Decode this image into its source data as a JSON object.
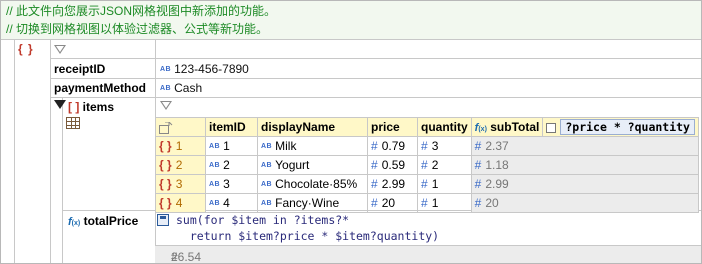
{
  "comments": [
    "// 此文件向您展示JSON网格视图中新添加的功能。",
    "// 切换到网格视图以体验过滤器、公式等新功能。"
  ],
  "root": {
    "brace": "{ }"
  },
  "fields": [
    {
      "key": "receiptID",
      "type_badge": "AB",
      "value": "123-456-7890"
    },
    {
      "key": "paymentMethod",
      "type_badge": "AB",
      "value": "Cash"
    }
  ],
  "items": {
    "brace": "[ ]",
    "key": "items",
    "columns": [
      "itemID",
      "displayName",
      "price",
      "quantity",
      "subTotal"
    ],
    "formula_header": "?price * ?quantity",
    "rows": [
      {
        "index": "1",
        "itemID": "1",
        "displayName": "Milk",
        "price": "0.79",
        "quantity": "3",
        "subTotal": "2.37"
      },
      {
        "index": "2",
        "itemID": "2",
        "displayName": "Yogurt",
        "price": "0.59",
        "quantity": "2",
        "subTotal": "1.18"
      },
      {
        "index": "3",
        "itemID": "3",
        "displayName": "Chocolate·85%",
        "price": "2.99",
        "quantity": "1",
        "subTotal": "2.99"
      },
      {
        "index": "4",
        "itemID": "4",
        "displayName": "Fancy·Wine",
        "price": "20",
        "quantity": "1",
        "subTotal": "20"
      }
    ]
  },
  "totalPrice": {
    "key": "totalPrice",
    "code_line1": "sum(for $item in ?items?*",
    "code_line2": "  return $item?price * $item?quantity)",
    "result": "26.54"
  },
  "symbols": {
    "hash": "#",
    "fx": "f(x)"
  }
}
